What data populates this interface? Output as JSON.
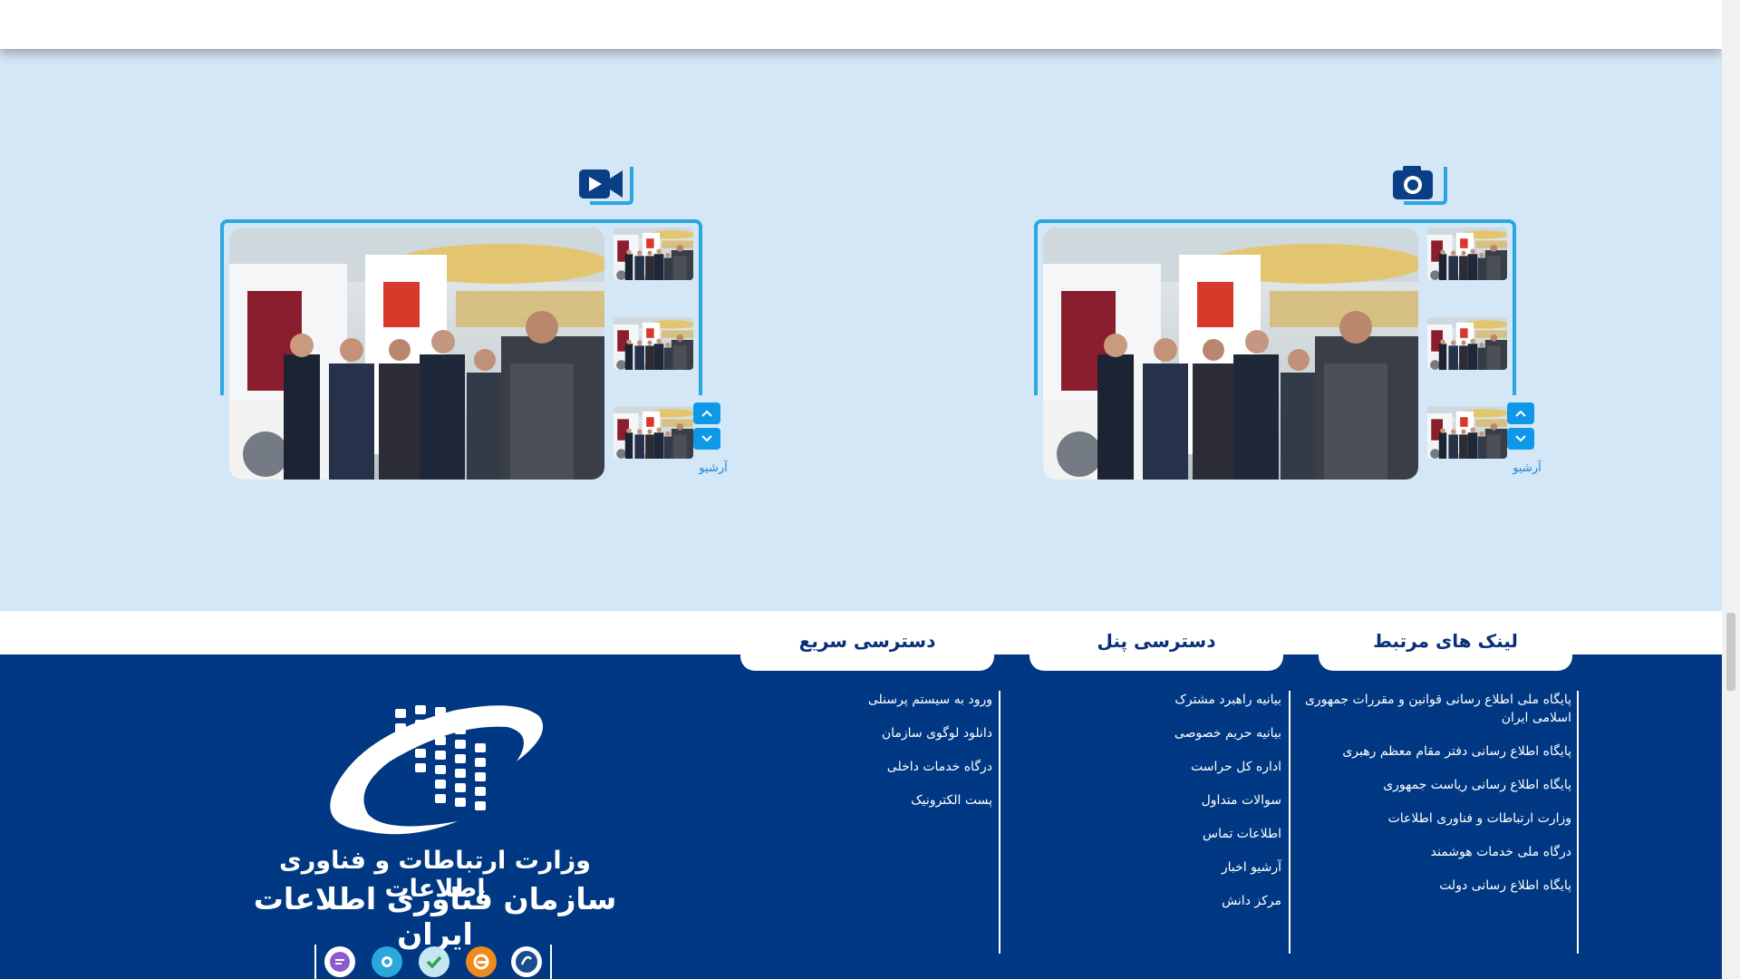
{
  "media": {
    "photo_gallery": {
      "archive_label": "آرشیو"
    },
    "video_gallery": {
      "archive_label": "آرشیو"
    }
  },
  "footer": {
    "tabs": {
      "related_links": "لینک های مرتبط",
      "panel_access": "دسترسی پنل",
      "quick_access": "دسترسی سریع"
    },
    "related_links": [
      "پایگاه ملی اطلاع رسانی قوانین و مقررات جمهوری اسلامی ایران",
      "پایگاه اطلاع رسانی دفتر مقام معظم رهبری",
      "پایگاه اطلاع رسانی ریاست جمهوری",
      "وزارت ارتباطات و فناوری اطلاعات",
      "درگاه ملی خدمات هوشمند",
      "پایگاه اطلاع رسانی دولت"
    ],
    "panel_access": [
      "بیانیه راهبرد مشترک",
      "بیانیه حریم خصوصی",
      "اداره کل حراست",
      "سوالات متداول",
      "اطلاعات تماس",
      "آرشیو اخبار",
      "مرکز دانش"
    ],
    "quick_access": [
      "ورود به سیستم پرسنلی",
      "دانلود لوگوی سازمان",
      "درگاه خدمات داخلی",
      "پست الکترونیک"
    ],
    "logo": {
      "line1": "وزارت ارتباطات و فناوری اطلاعات",
      "line2": "سازمان فناوری اطلاعات ایران"
    }
  },
  "colors": {
    "media_bg": "#d4e7f7",
    "footer_bg": "#003883",
    "accent": "#2ba6e0",
    "arrow_btn": "#1098e8"
  },
  "icons": [
    "camera-icon",
    "video-camera-icon",
    "chevron-up-icon",
    "chevron-down-icon",
    "social-messenger-icon"
  ]
}
